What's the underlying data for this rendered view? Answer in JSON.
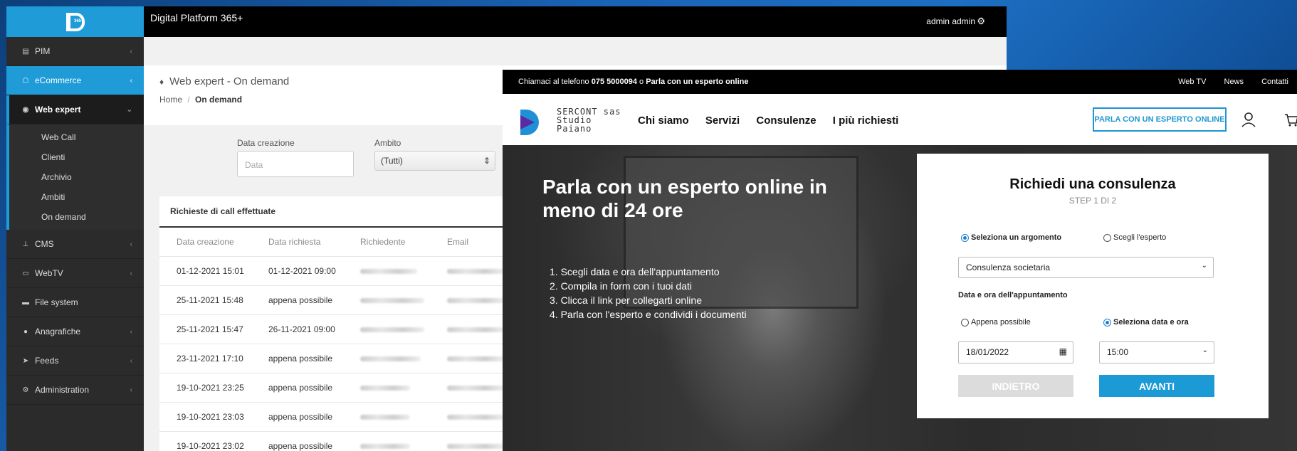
{
  "admin": {
    "app_title": "Digital Platform 365+",
    "logo_badge": "365+",
    "user": "admin admin",
    "sidebar": {
      "items": [
        {
          "label": "PIM"
        },
        {
          "label": "eCommerce"
        },
        {
          "label": "Web expert"
        },
        {
          "label": "CMS"
        },
        {
          "label": "WebTV"
        },
        {
          "label": "File system"
        },
        {
          "label": "Anagrafiche"
        },
        {
          "label": "Feeds"
        },
        {
          "label": "Administration"
        }
      ],
      "subitems": [
        "Web Call",
        "Clienti",
        "Archivio",
        "Ambiti",
        "On demand"
      ]
    },
    "page_title": "Web expert - On demand",
    "breadcrumb_home": "Home",
    "breadcrumb_sep": "/",
    "breadcrumb_current": "On demand",
    "filters": {
      "data_label": "Data creazione",
      "data_placeholder": "Data",
      "ambito_label": "Ambito",
      "ambito_value": "(Tutti)"
    },
    "panel_title": "Richieste di call effettuate",
    "table": {
      "headers": [
        "Data creazione",
        "Data richiesta",
        "Richiedente",
        "Email"
      ],
      "rows": [
        [
          "01-12-2021 15:01",
          "01-12-2021 09:00"
        ],
        [
          "25-11-2021 15:48",
          "appena possibile"
        ],
        [
          "25-11-2021 15:47",
          "26-11-2021 09:00"
        ],
        [
          "23-11-2021 17:10",
          "appena possibile"
        ],
        [
          "19-10-2021 23:25",
          "appena possibile"
        ],
        [
          "19-10-2021 23:03",
          "appena possibile"
        ],
        [
          "19-10-2021 23:02",
          "appena possibile"
        ]
      ]
    }
  },
  "site": {
    "topbar_prefix": "Chiamaci al telefono",
    "phone": "075 5000094",
    "topbar_or": "o",
    "topbar_cta": "Parla con un esperto online",
    "top_links": [
      "Web TV",
      "News",
      "Contatti"
    ],
    "logo_lines": [
      "SERCONT sas",
      "Studio",
      "Paiano"
    ],
    "nav": [
      "Chi siamo",
      "Servizi",
      "Consulenze",
      "I più richiesti"
    ],
    "expert_button": "PARLA CON UN ESPERTO ONLINE",
    "hero_title": "Parla con un esperto online in meno di 24 ore",
    "steps": [
      "1. Scegli data e ora dell'appuntamento",
      "2. Compila in form con i tuoi dati",
      "3. Clicca il link per collegarti online",
      "4. Parla con l'esperto e condividi i documenti"
    ],
    "form": {
      "title": "Richiedi una consulenza",
      "step": "STEP 1 DI 2",
      "radio_argomento": "Seleziona un argomento",
      "radio_esperto": "Scegli l'esperto",
      "argomento_value": "Consulenza societaria",
      "datetime_label": "Data e ora dell'appuntamento",
      "radio_asap": "Appena possibile",
      "radio_select": "Seleziona data e ora",
      "date_value": "18/01/2022",
      "time_value": "15:00",
      "back_button": "INDIETRO",
      "next_button": "AVANTI"
    }
  }
}
